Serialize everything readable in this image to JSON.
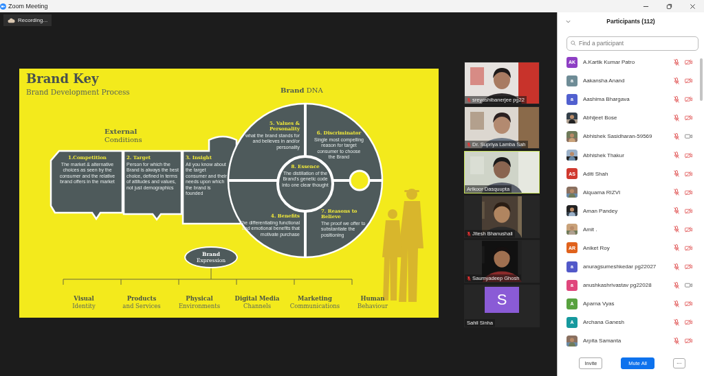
{
  "window": {
    "title": "Zoom Meeting"
  },
  "recording": {
    "label": "Recording..."
  },
  "slide": {
    "title": "Brand Key",
    "subtitle": "Brand Development Process",
    "external": {
      "heading": "External",
      "subheading": "Conditions"
    },
    "dna": "**Brand** DNA",
    "segments": [
      {
        "title": "1.Competition",
        "body": "The market & alternative choices as seen by the consumer and the relative brand offers in the market"
      },
      {
        "title": "2. Target",
        "body": "Person for which the Brand is always the best choice, defined in terms of attitudes and values, not just demographics"
      },
      {
        "title": "3. Insight",
        "body": "All you know about the target consumer and their needs upon which the brand is founded"
      },
      {
        "title": "5. Values & Personality",
        "body": "what the brand stands for and believes in and/or personality"
      },
      {
        "title": "6. Discriminator",
        "body": "Single most compelling reason for target consumer to choose the Brand"
      },
      {
        "title": "8. Essence",
        "body": "The distillation of the Brand's genetic code into one clear thought"
      },
      {
        "title": "4. Benefits",
        "body": "The differentiating functional and emotional benefits that motivate purchase"
      },
      {
        "title": "7. Reasons to Believe",
        "body": "The proof we offer to substantiate the positioning"
      }
    ],
    "expression": {
      "title": "Brand",
      "subtitle": "Expression"
    },
    "outputs": [
      {
        "title": "Visual",
        "subtitle": "Identity"
      },
      {
        "title": "Products",
        "subtitle": "and Services"
      },
      {
        "title": "Physical",
        "subtitle": "Environments"
      },
      {
        "title": "Digital Media",
        "subtitle": "Channels"
      },
      {
        "title": "Marketing",
        "subtitle": "Communications"
      },
      {
        "title": "Human",
        "subtitle": "Behaviour"
      }
    ]
  },
  "videos": [
    {
      "name": "sreyoshibanerjee pg22",
      "kind": "video",
      "muted": true,
      "active": false
    },
    {
      "name": "Dr. Supriya Lamba Sah",
      "kind": "video",
      "muted": true,
      "active": false
    },
    {
      "name": "Arikoor Dasquupta",
      "kind": "video",
      "muted": false,
      "active": true
    },
    {
      "name": "Jitesh Bhanushali",
      "kind": "portrait",
      "muted": true,
      "active": false
    },
    {
      "name": "Saumyadeep Ghosh",
      "kind": "portrait",
      "muted": true,
      "active": false
    },
    {
      "name": "Sahil Sinha",
      "kind": "avatar",
      "letter": "S",
      "color": "#8a5bd6",
      "muted": false,
      "active": false
    }
  ],
  "participants": {
    "title": "Participants (112)",
    "search": {
      "placeholder": "Find a participant"
    },
    "items": [
      {
        "name": "A.Kartik Kumar Patro",
        "avatar": {
          "kind": "initials",
          "text": "AK",
          "color": "#8e3fc4"
        },
        "mic_muted": true,
        "video_off": true
      },
      {
        "name": "Aakansha Anand",
        "avatar": {
          "kind": "initials",
          "text": "a",
          "color": "#6e8c96"
        },
        "mic_muted": true,
        "video_off": true
      },
      {
        "name": "Aashima Bhargava",
        "avatar": {
          "kind": "initials",
          "text": "a",
          "color": "#5160cf"
        },
        "mic_muted": true,
        "video_off": true
      },
      {
        "name": "Abhijeet Bose",
        "mic_muted": true,
        "video_off": true
      },
      {
        "name": "Abhishek Sasidharan-59569",
        "mic_muted": true,
        "video_off": false
      },
      {
        "name": "Abhishek Thakur",
        "mic_muted": true,
        "video_off": true
      },
      {
        "name": "Aditi Shah",
        "avatar": {
          "kind": "initials",
          "text": "AS",
          "color": "#d0392f"
        },
        "mic_muted": true,
        "video_off": true
      },
      {
        "name": "Alquama RIZVI",
        "mic_muted": true,
        "video_off": true
      },
      {
        "name": "Aman Pandey",
        "mic_muted": true,
        "video_off": true
      },
      {
        "name": "Amit .",
        "mic_muted": true,
        "video_off": true
      },
      {
        "name": "Aniket Roy",
        "avatar": {
          "kind": "initials",
          "text": "AR",
          "color": "#e0621c"
        },
        "mic_muted": true,
        "video_off": true
      },
      {
        "name": "anuragsumeshkedar pg22027",
        "avatar": {
          "kind": "initials",
          "text": "a",
          "color": "#5259c9"
        },
        "mic_muted": true,
        "video_off": true
      },
      {
        "name": "anushkashrivastav pg22028",
        "avatar": {
          "kind": "initials",
          "text": "a",
          "color": "#e0467c"
        },
        "mic_muted": true,
        "video_off": false
      },
      {
        "name": "Aparna Vyas",
        "avatar": {
          "kind": "initials",
          "text": "A",
          "color": "#58a23f"
        },
        "mic_muted": true,
        "video_off": true
      },
      {
        "name": "Archana Ganesh",
        "avatar": {
          "kind": "initials",
          "text": "A",
          "color": "#16999e"
        },
        "mic_muted": true,
        "video_off": true
      },
      {
        "name": "Arpita Samanta",
        "mic_muted": true,
        "video_off": true
      }
    ],
    "buttons": [
      {
        "label": "Invite",
        "kind": "plain"
      },
      {
        "label": "Mute All",
        "kind": "primary"
      },
      {
        "label": "···",
        "kind": "more"
      }
    ]
  }
}
